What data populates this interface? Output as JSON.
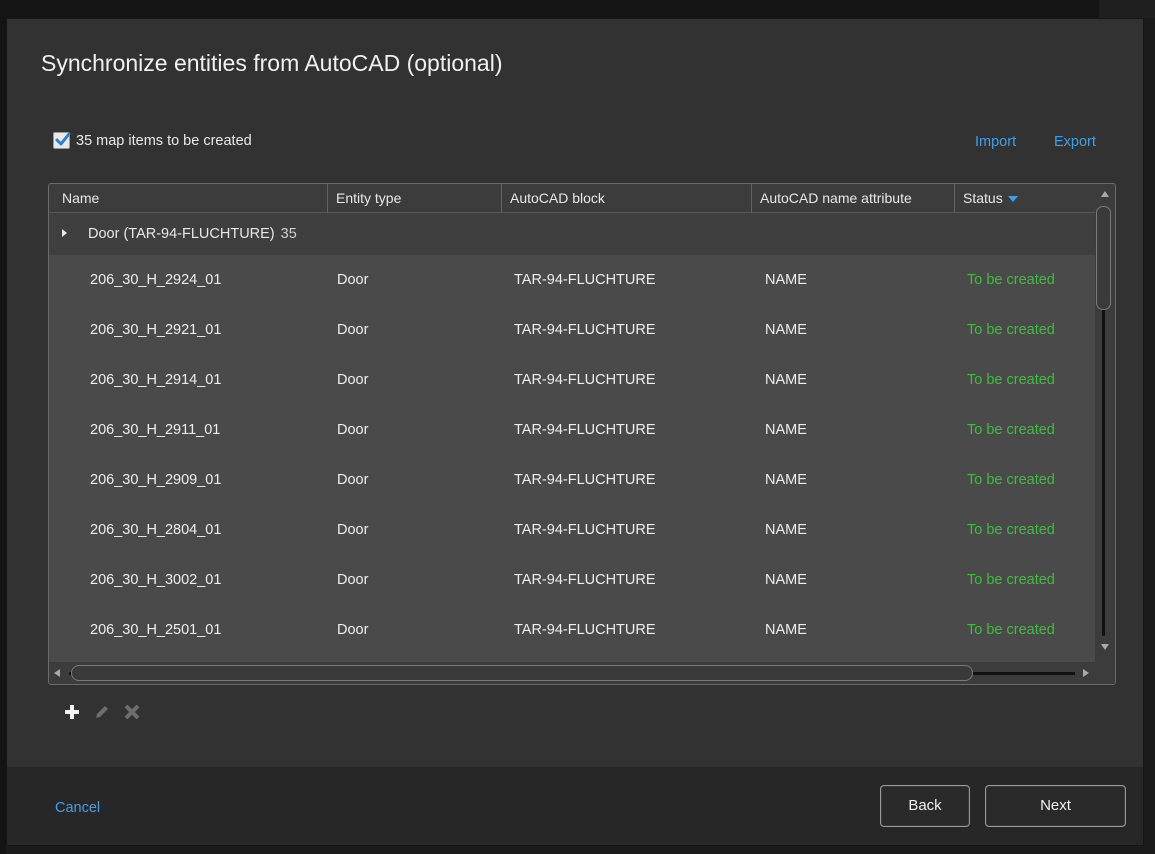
{
  "dialog": {
    "title": "Synchronize entities from AutoCAD (optional)"
  },
  "toolbar": {
    "checkbox_checked": true,
    "checkbox_label": "35 map items to be created",
    "import_label": "Import",
    "export_label": "Export"
  },
  "table": {
    "columns": [
      "Name",
      "Entity type",
      "AutoCAD block",
      "AutoCAD name attribute",
      "Status"
    ],
    "group": {
      "label": "Door (TAR-94-FLUCHTURE)",
      "count": "35"
    },
    "rows": [
      {
        "name": "206_30_H_2924_01",
        "type": "Door",
        "block": "TAR-94-FLUCHTURE",
        "attr": "NAME",
        "status": "To be created"
      },
      {
        "name": "206_30_H_2921_01",
        "type": "Door",
        "block": "TAR-94-FLUCHTURE",
        "attr": "NAME",
        "status": "To be created"
      },
      {
        "name": "206_30_H_2914_01",
        "type": "Door",
        "block": "TAR-94-FLUCHTURE",
        "attr": "NAME",
        "status": "To be created"
      },
      {
        "name": "206_30_H_2911_01",
        "type": "Door",
        "block": "TAR-94-FLUCHTURE",
        "attr": "NAME",
        "status": "To be created"
      },
      {
        "name": "206_30_H_2909_01",
        "type": "Door",
        "block": "TAR-94-FLUCHTURE",
        "attr": "NAME",
        "status": "To be created"
      },
      {
        "name": "206_30_H_2804_01",
        "type": "Door",
        "block": "TAR-94-FLUCHTURE",
        "attr": "NAME",
        "status": "To be created"
      },
      {
        "name": "206_30_H_3002_01",
        "type": "Door",
        "block": "TAR-94-FLUCHTURE",
        "attr": "NAME",
        "status": "To be created"
      },
      {
        "name": "206_30_H_2501_01",
        "type": "Door",
        "block": "TAR-94-FLUCHTURE",
        "attr": "NAME",
        "status": "To be created"
      }
    ]
  },
  "row_actions": {
    "icons": [
      "plus-icon",
      "pencil-icon",
      "x-icon"
    ]
  },
  "footer": {
    "cancel_label": "Cancel",
    "back_label": "Back",
    "next_label": "Next"
  },
  "colors": {
    "accent": "#3fa0ea",
    "status_green": "#3dbf3d",
    "background": "#323232"
  }
}
